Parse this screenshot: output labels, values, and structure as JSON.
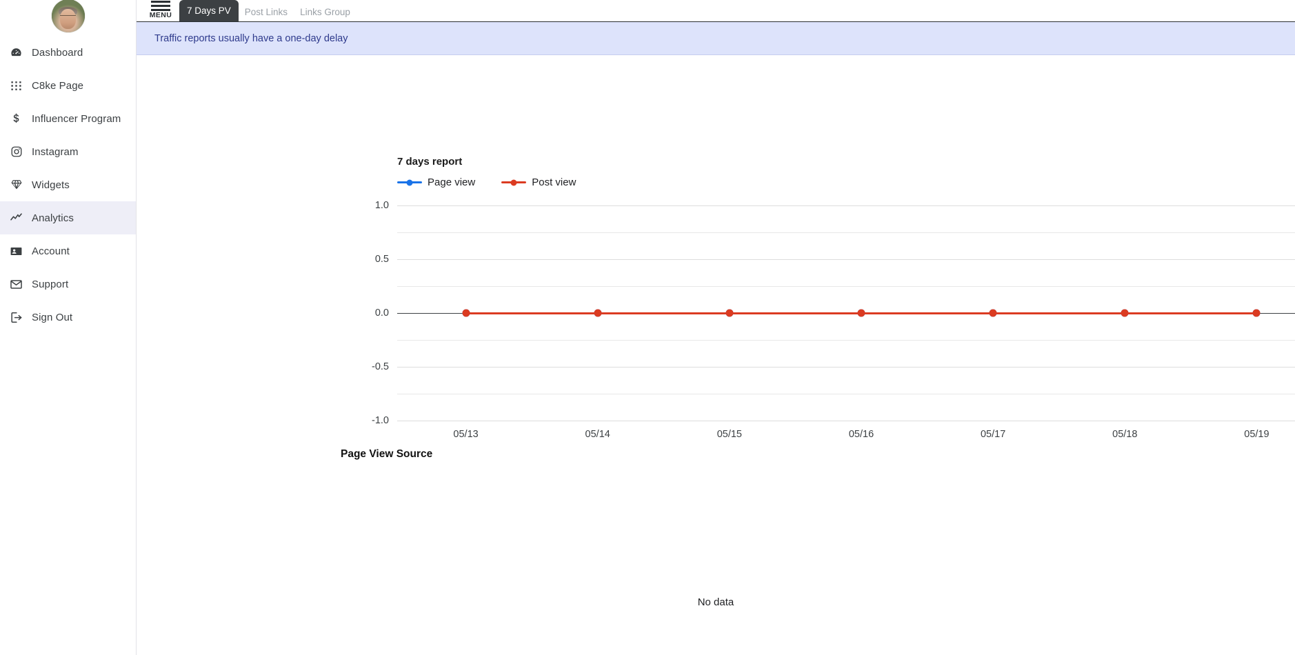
{
  "sidebar": {
    "avatar": {
      "name": "user-avatar",
      "alt": "User profile photo"
    },
    "items": [
      {
        "label": "Dashboard",
        "icon": "dashboard-icon",
        "active": false
      },
      {
        "label": "C8ke Page",
        "icon": "grid-apps-icon",
        "active": false
      },
      {
        "label": "Influencer Program",
        "icon": "dollar-icon",
        "active": false
      },
      {
        "label": "Instagram",
        "icon": "instagram-icon",
        "active": false
      },
      {
        "label": "Widgets",
        "icon": "diamond-icon",
        "active": false
      },
      {
        "label": "Analytics",
        "icon": "trend-line-icon",
        "active": true
      },
      {
        "label": "Account",
        "icon": "contact-card-icon",
        "active": false
      },
      {
        "label": "Support",
        "icon": "envelope-icon",
        "active": false
      },
      {
        "label": "Sign Out",
        "icon": "sign-out-icon",
        "active": false
      }
    ]
  },
  "topbar": {
    "menu_label": "MENU",
    "tabs": [
      {
        "label": "7 Days PV",
        "active": true
      },
      {
        "label": "Post Links",
        "active": false
      },
      {
        "label": "Links Group",
        "active": false
      }
    ]
  },
  "notice": {
    "text": "Traffic reports usually have a one-day delay"
  },
  "source_section": {
    "title": "Page View Source",
    "empty_text": "No data"
  },
  "colors": {
    "page_view": "#1a73e8",
    "post_view": "#db3b21",
    "tab_active_bg": "#3c4043",
    "notice_bg": "#dde3fb",
    "notice_text": "#2e3a8c",
    "sidebar_active_bg": "#eeeef7"
  },
  "chart_data": {
    "type": "line",
    "title": "7 days report",
    "xlabel": "",
    "ylabel": "",
    "grid": true,
    "legend_position": "top-left",
    "categories": [
      "05/13",
      "05/14",
      "05/15",
      "05/16",
      "05/17",
      "05/18",
      "05/19"
    ],
    "ylim": [
      -1.0,
      1.0
    ],
    "yticks": [
      "1.0",
      "0.5",
      "0.0",
      "-0.5",
      "-1.0"
    ],
    "ytick_values": [
      1.0,
      0.5,
      0.0,
      -0.5,
      -1.0
    ],
    "minor_gridlines": [
      0.75,
      0.25,
      -0.25,
      -0.75
    ],
    "series": [
      {
        "name": "Page view",
        "color": "#1a73e8",
        "values": [
          0,
          0,
          0,
          0,
          0,
          0,
          0
        ]
      },
      {
        "name": "Post view",
        "color": "#db3b21",
        "values": [
          0,
          0,
          0,
          0,
          0,
          0,
          0
        ]
      }
    ]
  }
}
